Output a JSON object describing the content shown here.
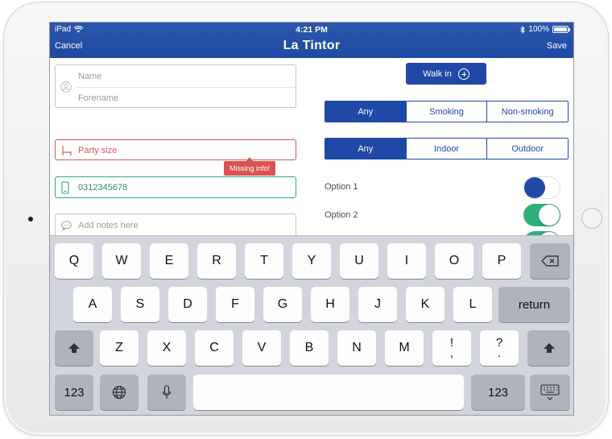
{
  "status_bar": {
    "device": "iPad",
    "time": "4:21 PM",
    "battery": "100%"
  },
  "nav": {
    "cancel": "Cancel",
    "title": "La Tintor",
    "save": "Save"
  },
  "form": {
    "name_placeholder": "Name",
    "forename_placeholder": "Forename",
    "party_size_label": "Party size",
    "missing_tooltip": "Missing info!",
    "phone_value": "0312345678",
    "notes_placeholder": "Add notes here"
  },
  "walk_in": {
    "label": "Walk in"
  },
  "smoking_options": [
    "Any",
    "Smoking",
    "Non-smoking"
  ],
  "smoking_selected": "Any",
  "location_options": [
    "Any",
    "Indoor",
    "Outdoor"
  ],
  "location_selected": "Any",
  "options": [
    {
      "label": "Option 1",
      "on": false
    },
    {
      "label": "Option 2",
      "on": true
    }
  ],
  "colors": {
    "brand_blue": "#2048a6",
    "error_red": "#d9534f",
    "success_green": "#2fb07a"
  },
  "keyboard": {
    "row1": [
      "Q",
      "W",
      "E",
      "R",
      "T",
      "Y",
      "U",
      "I",
      "O",
      "P"
    ],
    "row2": [
      "A",
      "S",
      "D",
      "F",
      "G",
      "H",
      "J",
      "K",
      "L"
    ],
    "row3": [
      "Z",
      "X",
      "C",
      "V",
      "B",
      "N",
      "M"
    ],
    "exclaim_top": "!",
    "exclaim_bottom": ",",
    "question_top": "?",
    "question_bottom": ".",
    "return": "return",
    "numbers_left": "123",
    "numbers_right": "123"
  }
}
